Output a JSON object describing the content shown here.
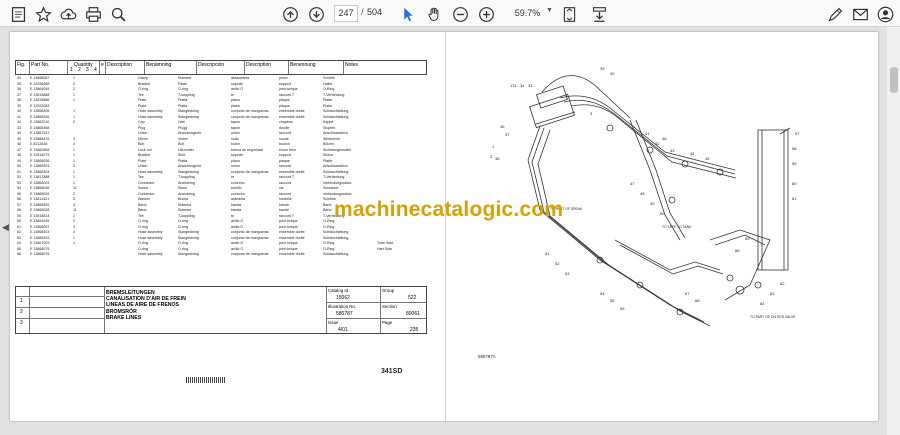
{
  "toolbar": {
    "current_page": "247",
    "page_separator": "/",
    "total_pages": "504",
    "zoom": "59.7%"
  },
  "parts_table": {
    "headers": {
      "fig": "Fig.",
      "part_no": "Part No.",
      "quantity": "Quantity",
      "q1": "1",
      "q2": "2",
      "q3": "3",
      "q4": "4",
      "e": "e",
      "description": "Description",
      "benamning": "Benämning",
      "descripcion": "Descripción",
      "description_fr": "Description",
      "benennung": "Benennung",
      "notes": "Notes"
    },
    "rows": [
      {
        "fig": "34",
        "part": "E 13868087",
        "qty": "1",
        "desc": "Clamp",
        "sv": "Klamma",
        "es": "abrazadera",
        "fr": "pince",
        "de": "Schelle"
      },
      {
        "fig": "35",
        "part": "E 12936058",
        "qty": "2",
        "desc": "Bracket",
        "sv": "Fäste",
        "es": "soporte",
        "fr": "support",
        "de": "Halter"
      },
      {
        "fig": "36",
        "part": "E 13864045",
        "qty": "2",
        "desc": "O-ring",
        "sv": "O-ring",
        "es": "anillo O",
        "fr": "joint torique",
        "de": "O-Ring"
      },
      {
        "fig": "37",
        "part": "E 13815888",
        "qty": "1",
        "desc": "Tee",
        "sv": "T-koppling",
        "es": "te",
        "fr": "raccord T",
        "de": "T-Verbindung"
      },
      {
        "fig": "38",
        "part": "E 13815856",
        "qty": "1",
        "desc": "Plate",
        "sv": "Platta",
        "es": "placa",
        "fr": "plaque",
        "de": "Platte"
      },
      {
        "fig": "39",
        "part": "E 12922083",
        "qty": "",
        "desc": "Plate",
        "sv": "Platta",
        "es": "placa",
        "fr": "plaque",
        "de": "Platte"
      },
      {
        "fig": "40",
        "part": "E 13868305",
        "qty": "1",
        "desc": "Hose assembly",
        "sv": "Slangledning",
        "es": "conjunto de mangueras",
        "fr": "ensemble durite",
        "de": "Schlauchleitung"
      },
      {
        "fig": "41",
        "part": "E 13868306",
        "qty": "1",
        "desc": "Hose assembly",
        "sv": "Slangledning",
        "es": "conjunto de mangueras",
        "fr": "ensemble durite",
        "de": "Schlauchleitung"
      },
      {
        "fig": "42",
        "part": "E 13863210",
        "qty": "2",
        "desc": "Cap",
        "sv": "Hatt",
        "es": "tapón",
        "fr": "chapeau",
        "de": "Kappe"
      },
      {
        "fig": "43",
        "part": "E 13868468",
        "qty": "",
        "desc": "Plug",
        "sv": "Plugg",
        "es": "tapón",
        "fr": "douille",
        "de": "Stopfen"
      },
      {
        "fig": "44",
        "part": "E 13867347",
        "qty": "",
        "desc": "Union",
        "sv": "Anslutningsrör",
        "es": "unión",
        "fr": "raccord",
        "de": "Anschlussstück"
      },
      {
        "fig": "45",
        "part": "E 13868476",
        "qty": "3",
        "desc": "Elbow",
        "sv": "Vinkel",
        "es": "codo",
        "fr": "coude",
        "de": "Winkelrohr"
      },
      {
        "fig": "46",
        "part": "E 8212628",
        "qty": "4",
        "desc": "Bolt",
        "sv": "Bult",
        "es": "bulón",
        "fr": "boulon",
        "de": "Bolzen"
      },
      {
        "fig": "47",
        "part": "E 13862808",
        "qty": "1",
        "desc": "Lock nut",
        "sv": "Låsmutter",
        "es": "tuerca de seguridad",
        "fr": "écrou frein",
        "de": "Sicherungsmutter"
      },
      {
        "fig": "48",
        "part": "E 12518279",
        "qty": "1",
        "desc": "Bracket",
        "sv": "Stöd",
        "es": "soporte",
        "fr": "support",
        "de": "Stütze"
      },
      {
        "fig": "49",
        "part": "E 13868036",
        "qty": "1",
        "desc": "Plate",
        "sv": "Platta",
        "es": "placa",
        "fr": "plaque",
        "de": "Platte"
      },
      {
        "fig": "50",
        "part": "E 13868303",
        "qty": "3",
        "desc": "Union",
        "sv": "Anslutningsrör",
        "es": "unión",
        "fr": "raccord",
        "de": "Anschlussstück"
      },
      {
        "fig": "51",
        "part": "E 13868304",
        "qty": "1",
        "desc": "Hose assembly",
        "sv": "Slangledning",
        "es": "conjunto de mangueras",
        "fr": "ensemble durite",
        "de": "Schlauchleitung"
      },
      {
        "fig": "52",
        "part": "E 13817888",
        "qty": "1",
        "desc": "Tee",
        "sv": "T-koppling",
        "es": "te",
        "fr": "raccord T",
        "de": "T-Verbindung"
      },
      {
        "fig": "53",
        "part": "E 13868003",
        "qty": "1",
        "desc": "Connector",
        "sv": "Anslutning",
        "es": "conector",
        "fr": "raccord",
        "de": "Verbindungsstück"
      },
      {
        "fig": "54",
        "part": "E 13868036",
        "qty": "11",
        "desc": "Screw",
        "sv": "Skruv",
        "es": "tornillo",
        "fr": "vis",
        "de": "Schraube"
      },
      {
        "fig": "55",
        "part": "E 13868026",
        "qty": "2",
        "desc": "Connector",
        "sv": "Anslutning",
        "es": "conector",
        "fr": "raccord",
        "de": "Verbindungsstück"
      },
      {
        "fig": "56",
        "part": "E 13811421",
        "qty": "3",
        "desc": "Washer",
        "sv": "Bricka",
        "es": "arandela",
        "fr": "rondelle",
        "de": "Scheibe"
      },
      {
        "fig": "57",
        "part": "E 13868309",
        "qty": "3",
        "desc": "Band",
        "sv": "Klamma",
        "es": "banda",
        "fr": "bande",
        "de": "Band"
      },
      {
        "fig": "58",
        "part": "E 13868028",
        "qty": "11",
        "desc": "Band",
        "sv": "Klamma",
        "es": "banda",
        "fr": "bande",
        "de": "Band"
      },
      {
        "fig": "59",
        "part": "E 13818814",
        "qty": "1",
        "desc": "Tee",
        "sv": "T-koppling",
        "es": "te",
        "fr": "raccord T",
        "de": "T-Verbindung"
      },
      {
        "fig": "60",
        "part": "E 13864045",
        "qty": "2",
        "desc": "O-ring",
        "sv": "O-ring",
        "es": "anillo O",
        "fr": "joint torique",
        "de": "O-Ring"
      },
      {
        "fig": "61",
        "part": "E 13868057",
        "qty": "3",
        "desc": "O-ring",
        "sv": "O-ring",
        "es": "anillo O",
        "fr": "joint torique",
        "de": "O-Ring"
      },
      {
        "fig": "62",
        "part": "E 13868303",
        "qty": "4",
        "desc": "Hose assembly",
        "sv": "Slangledning",
        "es": "conjunto de mangueras",
        "fr": "ensemble durite",
        "de": "Schlauchleitung"
      },
      {
        "fig": "63",
        "part": "E 13868303",
        "qty": "1",
        "desc": "Hose assembly",
        "sv": "Slangledning",
        "es": "conjunto de mangueras",
        "fr": "ensemble durite",
        "de": "Schlauchleitung"
      },
      {
        "fig": "64",
        "part": "E 13867009",
        "qty": "1",
        "desc": "O-ring",
        "sv": "O-ring",
        "es": "anillo O",
        "fr": "joint torique",
        "de": "O-Ring",
        "note": "Tube Side"
      },
      {
        "fig": "65",
        "part": "E 13868075",
        "qty": "",
        "desc": "O-ring",
        "sv": "O-ring",
        "es": "anillo O",
        "fr": "joint torique",
        "de": "O-Ring",
        "note": "Hart Side"
      },
      {
        "fig": "66",
        "part": "E 13868076",
        "qty": "",
        "desc": "Hose assembly",
        "sv": "Slangledning",
        "es": "conjunto de mangueras",
        "fr": "ensemble durite",
        "de": "Schlauchleitung"
      }
    ]
  },
  "title_block": {
    "row_numbers": [
      "1",
      "2",
      "3"
    ],
    "titles": [
      "BREMSLEITUNGEN",
      "CANALISATION D'AIR DE FREIN",
      "LINEAS DE AIRE DE FRENOS",
      "BROMSRÖR",
      "BRAKE LINES"
    ],
    "catalog_id_label": "Catalog Id",
    "catalog_id_value": "15062",
    "group_label": "Group",
    "group_value": "522",
    "illustration_no_label": "Illustration No.",
    "illustration_no_value": "580787",
    "section_label": "Section",
    "section_value": "80061",
    "issue_label": "Issue",
    "issue_value": "4/01",
    "page_label": "Page",
    "page_value": "235",
    "model": "341SD"
  },
  "diagram": {
    "callouts": [
      "131",
      "34",
      "33",
      "36",
      "37",
      "38",
      "39",
      "40",
      "41",
      "42",
      "43",
      "44",
      "45",
      "46",
      "47",
      "48",
      "49",
      "50",
      "51",
      "52",
      "53",
      "54",
      "55",
      "56",
      "57",
      "58",
      "59",
      "60",
      "61",
      "62",
      "63",
      "64",
      "65",
      "66",
      "67",
      "68",
      "1",
      "2",
      "3"
    ],
    "note_tank": "TO TAPE TO TANK",
    "note_top": "TO PART OF SPEAK",
    "note_bottom": "TO PART OF ON RED VALVE",
    "drawing_no": "580787A"
  },
  "watermark": "machinecatalogic.com"
}
